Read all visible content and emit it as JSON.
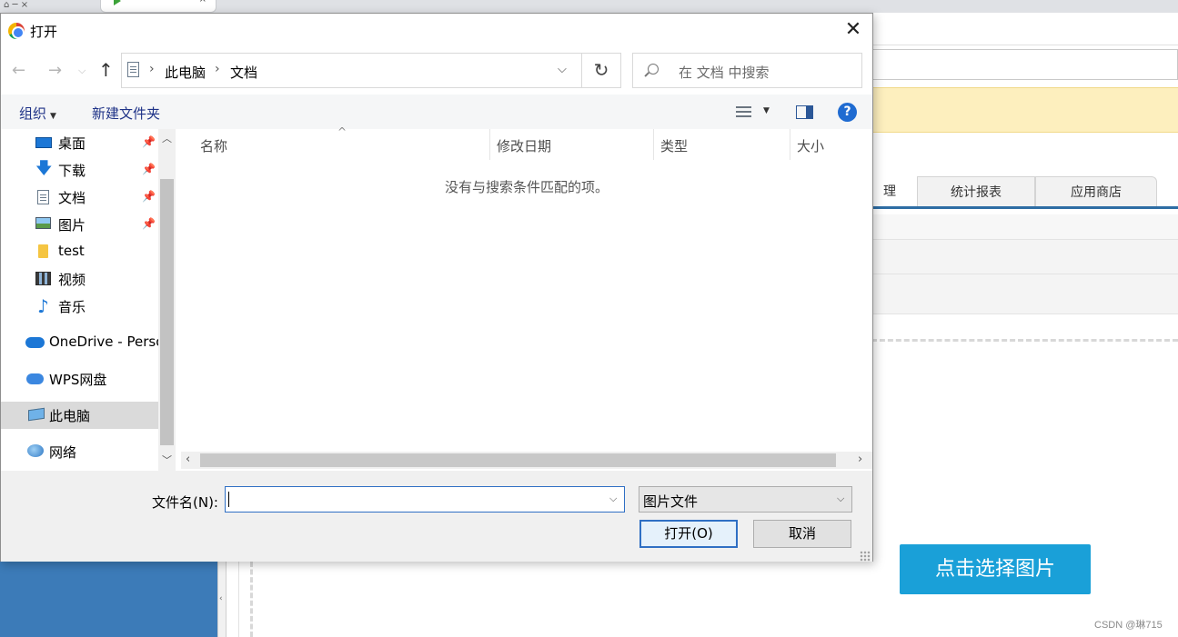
{
  "background": {
    "nav_tabs": [
      "理",
      "统计报表",
      "应用商店"
    ],
    "pick_image_button": "点击选择图片",
    "watermark": "CSDN @琳715",
    "home_tab_icon": "home-icon",
    "colors": {
      "notice_bar": "#fdefbe",
      "sidebar": "#3c7bb8",
      "pick_button": "#1aa0d8"
    }
  },
  "dialog": {
    "title": "打开",
    "app_icon": "chrome-icon",
    "breadcrumb": [
      "此电脑",
      "文档"
    ],
    "search_placeholder": "在 文档 中搜索",
    "toolbar": {
      "organize_label": "组织",
      "new_folder_label": "新建文件夹"
    },
    "nav_items": [
      {
        "label": "桌面",
        "icon": "desktop-icon",
        "pinned": true
      },
      {
        "label": "下载",
        "icon": "download-icon",
        "pinned": true
      },
      {
        "label": "文档",
        "icon": "document-icon",
        "pinned": true
      },
      {
        "label": "图片",
        "icon": "pictures-icon",
        "pinned": true
      },
      {
        "label": "test",
        "icon": "folder-icon",
        "pinned": false
      },
      {
        "label": "视频",
        "icon": "video-icon",
        "pinned": false
      },
      {
        "label": "音乐",
        "icon": "music-icon",
        "pinned": false
      },
      {
        "label": "OneDrive - Perso",
        "icon": "onedrive-icon",
        "pinned": false
      },
      {
        "label": "WPS网盘",
        "icon": "wps-cloud-icon",
        "pinned": false
      },
      {
        "label": "此电脑",
        "icon": "this-pc-icon",
        "pinned": false,
        "selected": true
      },
      {
        "label": "网络",
        "icon": "network-icon",
        "pinned": false
      }
    ],
    "columns": [
      "名称",
      "修改日期",
      "类型",
      "大小"
    ],
    "empty_message": "没有与搜索条件匹配的项。",
    "filename_label": "文件名(N):",
    "filename_value": "",
    "filetype_value": "图片文件",
    "open_button": "打开(O)",
    "cancel_button": "取消"
  }
}
